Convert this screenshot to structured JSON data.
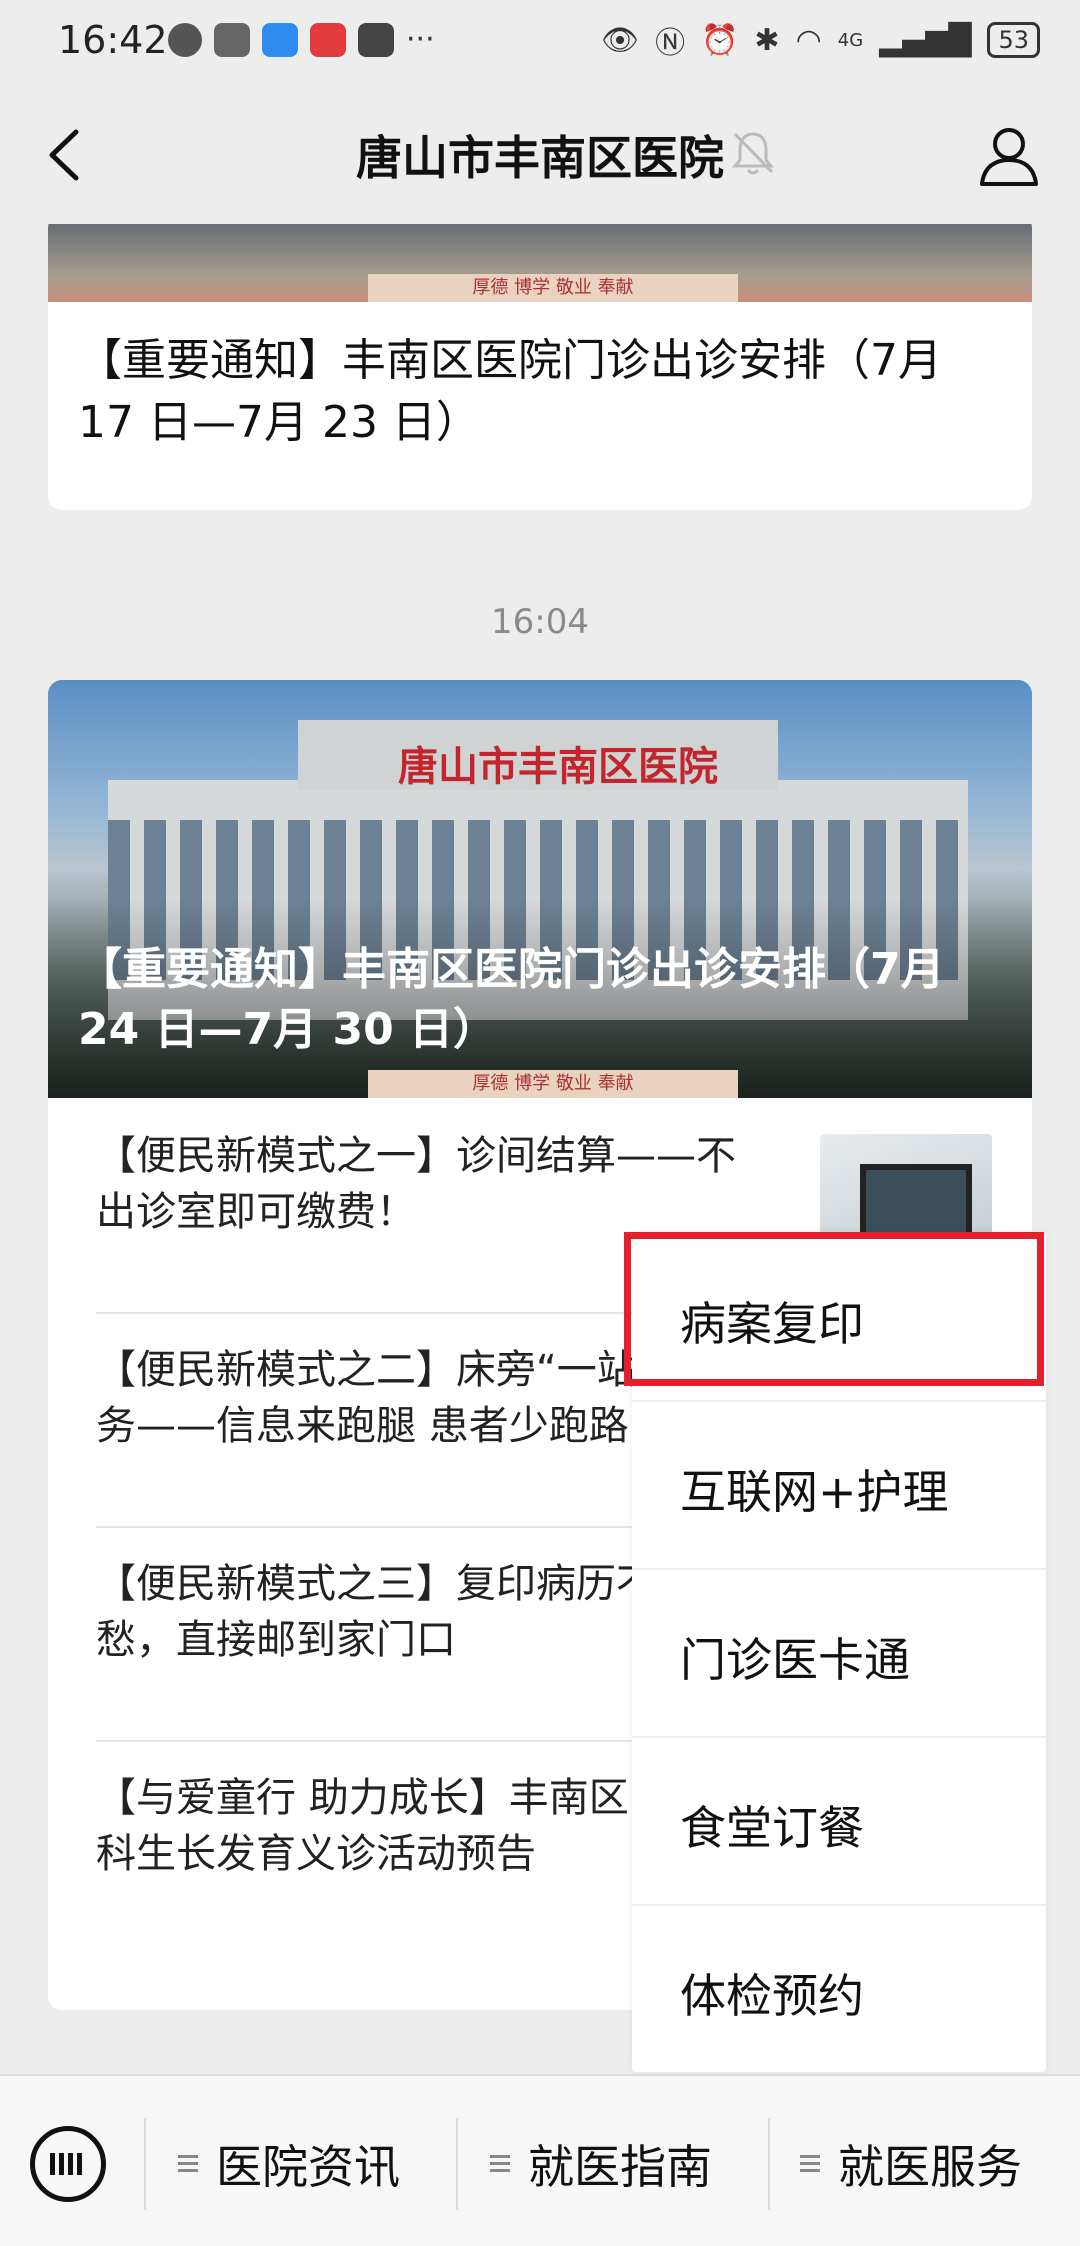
{
  "status_bar": {
    "time": "16:42",
    "network": "4G",
    "battery": "53"
  },
  "nav": {
    "title": "唐山市丰南区医院"
  },
  "feed": {
    "card1": {
      "sign": "厚德  博学  敬业  奉献",
      "title": "【重要通知】丰南区医院门诊出诊安排（7月 17 日—7月 23 日）"
    },
    "timestamp": "16:04",
    "card2": {
      "building_sign": "唐山市丰南区医院",
      "sign": "厚德  博学  敬业  奉献",
      "headline": "【重要通知】丰南区医院门诊出诊安排（7月 24 日—7月 30 日）",
      "articles": [
        {
          "title": "【便民新模式之一】诊间结算——不出诊室即可缴费！"
        },
        {
          "title": "【便民新模式之二】床旁“一站式”服务——信息来跑腿  患者少跑路"
        },
        {
          "title": "【便民新模式之三】复印病历不用愁，直接邮到家门口"
        },
        {
          "title": "【与爱童行 助力成长】丰南区医院儿科生长发育义诊活动预告"
        }
      ]
    }
  },
  "popup_menu": {
    "items": [
      "病案复印",
      "互联网+护理",
      "门诊医卡通",
      "食堂订餐",
      "体检预约"
    ],
    "highlight_color": "#e3202b"
  },
  "bottom_menu": {
    "tabs": [
      "医院资讯",
      "就医指南",
      "就医服务"
    ]
  }
}
